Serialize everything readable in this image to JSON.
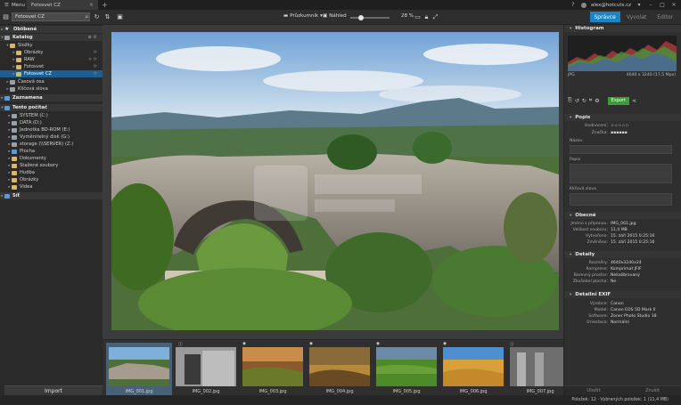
{
  "titlebar": {
    "menu_tab": "Menu",
    "doc_tab": "Fotosvet CZ",
    "user": "alex@hotcuts.cz"
  },
  "toolbar": {
    "search_value": "Fotosvet CZ",
    "view_dropdown": "Průzkumník",
    "filter_dropdown": "Náhled",
    "zoom_value": "28 %"
  },
  "modes": [
    "Správce",
    "Vyvolat",
    "Editor"
  ],
  "sidebar": {
    "favorites": "Oblíbené",
    "catalog": "Katalog",
    "folders": "Složky",
    "folder_items": [
      "Obrázky",
      "RAW",
      "Fotosvet",
      "Fotosvet CZ"
    ],
    "time_axis": "Časová osa",
    "keywords": "Klíčová slova",
    "marked": "Zaznamena",
    "this_pc": "Tento počítač",
    "drives": [
      "SYSTEM (C:)",
      "DATA (D:)",
      "Jednotka BD-ROM (E:)",
      "Vyměnitelný disk (G:)",
      "storage (\\\\SERVER) (Z:)",
      "Plocha",
      "Dokumenty",
      "Stažené soubory",
      "Hudba",
      "Obrázky",
      "Videa"
    ],
    "network": "Síť",
    "import_label": "Import"
  },
  "filmstrip": {
    "thumbs": [
      {
        "label": "IMG_001.jpg"
      },
      {
        "label": "IMG_002.jpg"
      },
      {
        "label": "IMG_003.jpg"
      },
      {
        "label": "IMG_004.jpg"
      },
      {
        "label": "IMG_005.jpg"
      },
      {
        "label": "IMG_006.jpg"
      },
      {
        "label": "IMG_007.jpg"
      }
    ]
  },
  "right_panel": {
    "histogram_title": "Histogram",
    "histogram_format": "JPG",
    "histogram_size": "4640 x 3240 (17,5 Mpx)",
    "export_label": "Export",
    "description_title": "Popis",
    "rating_label": "Hodnocení:",
    "tags_label": "Značka:",
    "title_label": "Název",
    "desc_label": "Popis",
    "keywords_label": "Klíčová slova",
    "general_title": "Obecné",
    "general_rows": [
      {
        "k": "Jméno s příponou:",
        "v": "IMG_001.jpg"
      },
      {
        "k": "Velikost souboru:",
        "v": "11,4 MB"
      },
      {
        "k": "Vytvořeno:",
        "v": "15. září 2015 0:25:16"
      },
      {
        "k": "Změněno:",
        "v": "15. září 2015 0:25:16"
      }
    ],
    "details_title": "Detaily",
    "details_rows": [
      {
        "k": "Rozměry:",
        "v": "4640x3240x24"
      },
      {
        "k": "Komprese:",
        "v": "Komprimat JFIF"
      },
      {
        "k": "Barevný prostor:",
        "v": "Nekalibrovaný"
      },
      {
        "k": "Zkušební plocha:",
        "v": "Ne"
      }
    ],
    "exif_title": "Detailní EXIF",
    "exif_rows": [
      {
        "k": "Výrobce:",
        "v": "Canon"
      },
      {
        "k": "Model:",
        "v": "Canon EOS 5D Mark II"
      },
      {
        "k": "Software:",
        "v": "Zoner Photo Studio 18"
      },
      {
        "k": "Orientace:",
        "v": "Normální"
      }
    ],
    "bottom_buttons": [
      "Uložit",
      "Zrušit"
    ]
  },
  "statusbar": {
    "text": "Položek: 12 · Vybraných položek: 1 (11,4 MB)"
  }
}
